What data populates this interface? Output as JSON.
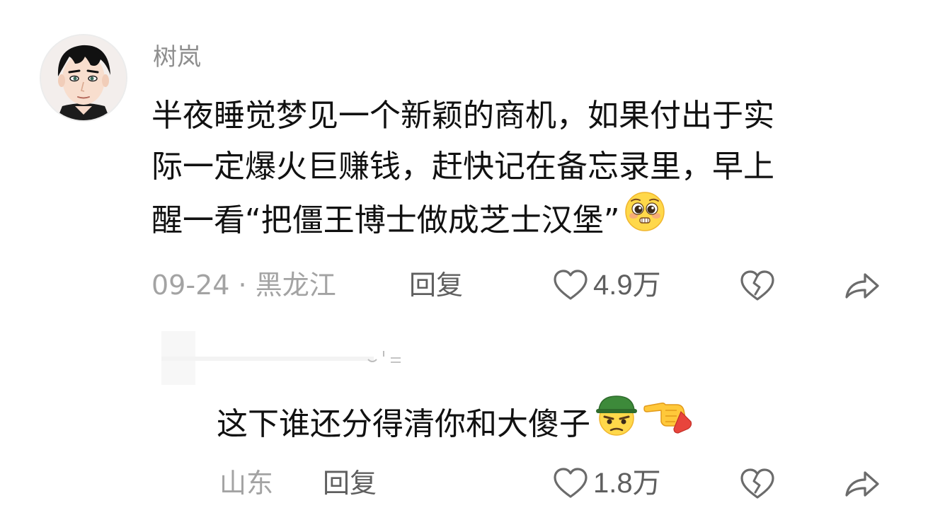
{
  "comment": {
    "username": "树岚",
    "lines": [
      "半夜睡觉梦见一个新颖的商机，如果付出于实",
      "际一定爆火巨赚钱，赶快记在备忘录里，早上",
      "醒一看“把僵王博士做成芝士汉堡”"
    ],
    "emoji": "pleading-face-emoji",
    "date": "09-24",
    "separator": "·",
    "location": "黑龙江",
    "reply_label": "回复",
    "like_count": "4.9万"
  },
  "reply": {
    "text": "这下谁还分得清你和大傻子",
    "emojis": [
      "helmet-angry-face-emoji",
      "pointing-left-hand-emoji"
    ],
    "location": "山东",
    "reply_label": "回复",
    "like_count": "1.8万"
  },
  "icons": {
    "like": "heart-outline-icon",
    "dislike": "broken-heart-icon",
    "share": "share-arrow-icon"
  },
  "colors": {
    "primary_text": "#111111",
    "secondary_text": "#8e8e8e",
    "meta_text": "#a3a3a3",
    "action_text": "#5f5f5f",
    "background": "#ffffff"
  }
}
